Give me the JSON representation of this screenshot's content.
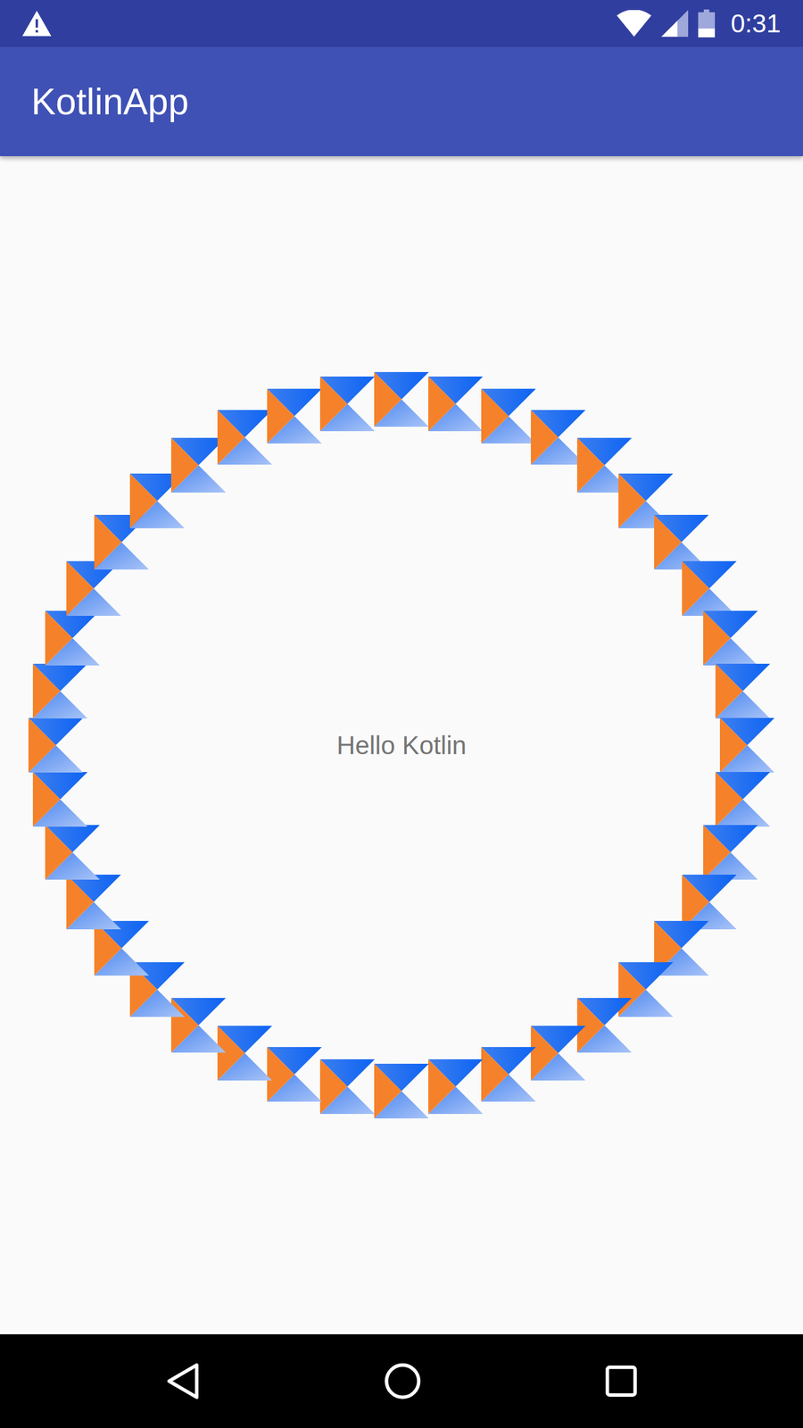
{
  "status_bar": {
    "time": "0:31",
    "signal": {
      "level": 0.6
    },
    "battery": {
      "level": 0.35
    }
  },
  "app_bar": {
    "title": "KotlinApp"
  },
  "content": {
    "text": "Hello Kotlin"
  }
}
